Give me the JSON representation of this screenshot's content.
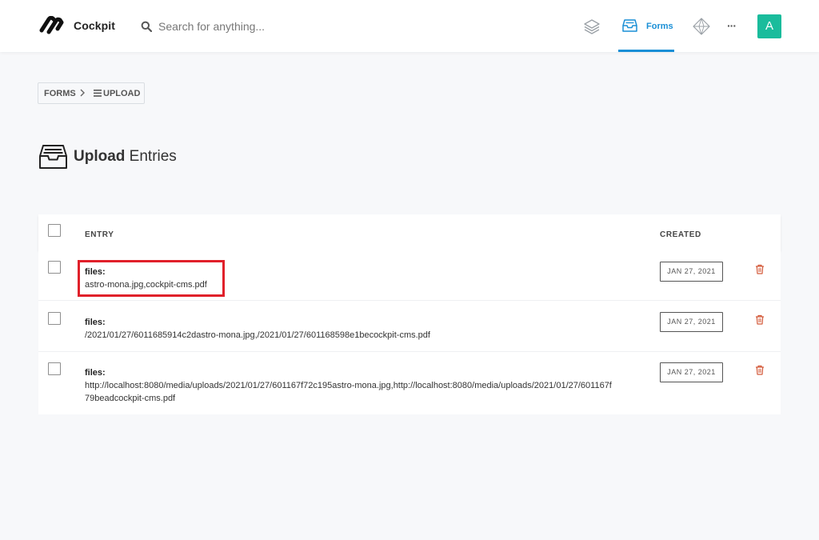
{
  "app": {
    "name": "Cockpit"
  },
  "search": {
    "placeholder": "Search for anything..."
  },
  "nav": {
    "forms_label": "Forms",
    "more_label": "···",
    "avatar_initial": "A",
    "active_color": "#1a8fd6",
    "avatar_color": "#1abc9c"
  },
  "breadcrumb": {
    "root": "FORMS",
    "current": "UPLOAD"
  },
  "page": {
    "title_strong": "Upload",
    "title_rest": "Entries"
  },
  "table": {
    "headers": {
      "entry": "ENTRY",
      "created": "CREATED"
    },
    "rows": [
      {
        "key": "files:",
        "value": "astro-mona.jpg,cockpit-cms.pdf",
        "created": "JAN 27, 2021"
      },
      {
        "key": "files:",
        "value": "/2021/01/27/6011685914c2dastro-mona.jpg,/2021/01/27/601168598e1becockpit-cms.pdf",
        "created": "JAN 27, 2021"
      },
      {
        "key": "files:",
        "value": "http://localhost:8080/media/uploads/2021/01/27/601167f72c195astro-mona.jpg,http://localhost:8080/media/uploads/2021/01/27/601167f79beadcockpit-cms.pdf",
        "created": "JAN 27, 2021"
      }
    ]
  },
  "colors": {
    "trash": "#d35a3a",
    "highlight": "#e0202a"
  }
}
